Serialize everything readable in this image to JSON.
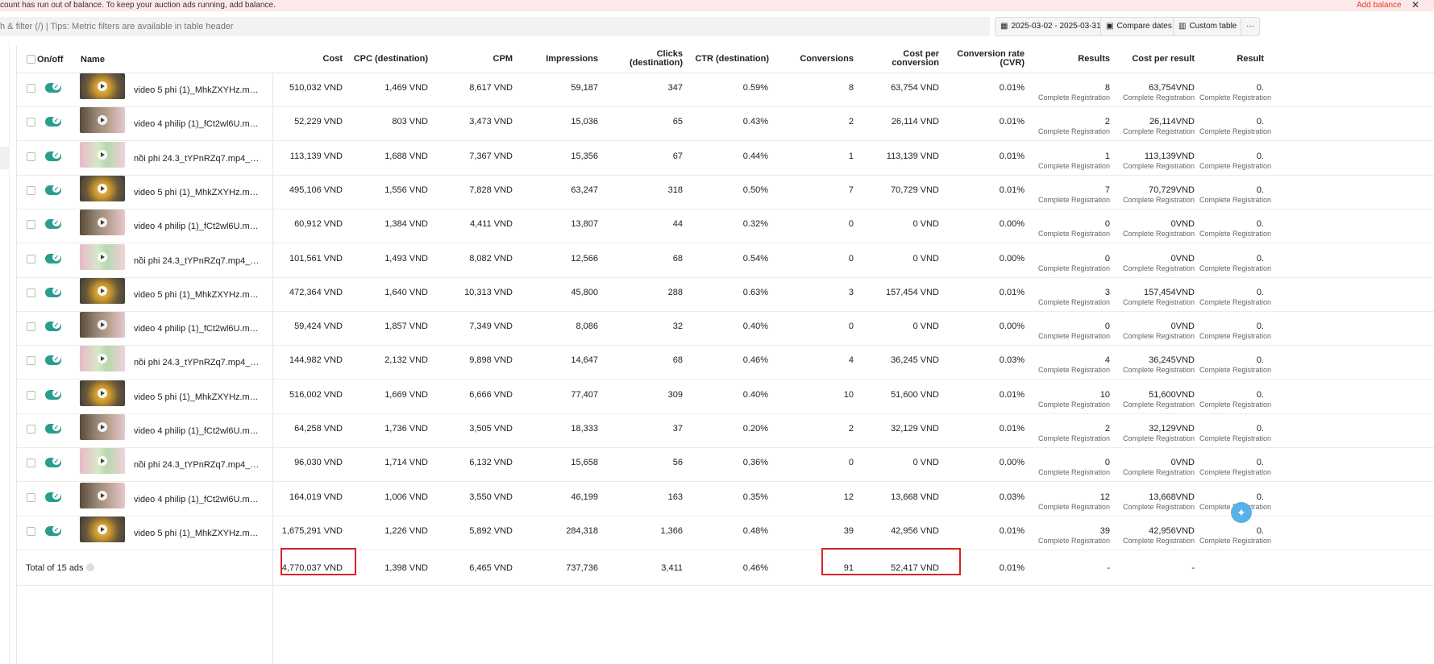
{
  "banner": {
    "message": "count has run out of balance. To keep your auction ads running, add balance.",
    "add_balance": "Add balance",
    "close": "✕"
  },
  "toolbar": {
    "search_placeholder": "h & filter (/) | Tips: Metric filters are available in table header",
    "date_range": "2025-03-02 - 2025-03-31",
    "compare_dates": "Compare dates",
    "custom_table": "Custom table",
    "more": "···"
  },
  "headers": {
    "onoff": "On/off",
    "name": "Name",
    "cost": "Cost",
    "cpc": "CPC (destination)",
    "cpm": "CPM",
    "impressions": "Impressions",
    "clicks_1": "Clicks",
    "clicks_2": "(destination)",
    "ctr": "CTR (destination)",
    "conversions": "Conversions",
    "cpconv_1": "Cost per",
    "cpconv_2": "conversion",
    "cvr_1": "Conversion rate",
    "cvr_2": "(CVR)",
    "results": "Results",
    "cpr": "Cost per result",
    "result_rate": "Result"
  },
  "sub_label": "Complete Registration",
  "rows": [
    {
      "thumb": "a",
      "name": "video 5 phi (1)_MhkZXYHz.mp4_Bả...",
      "cost": "510,032 VND",
      "cpc": "1,469 VND",
      "cpm": "8,617 VND",
      "impr": "59,187",
      "clicks": "347",
      "ctr": "0.59%",
      "conv": "8",
      "cpconv": "63,754 VND",
      "cvr": "0.01%",
      "results": "8",
      "cpr": "63,754VND",
      "rr": "0."
    },
    {
      "thumb": "b",
      "name": "video 4 philip (1)_fCt2wl6U.mp4_Bả...",
      "cost": "52,229 VND",
      "cpc": "803 VND",
      "cpm": "3,473 VND",
      "impr": "15,036",
      "clicks": "65",
      "ctr": "0.43%",
      "conv": "2",
      "cpconv": "26,114 VND",
      "cvr": "0.01%",
      "results": "2",
      "cpr": "26,114VND",
      "rr": "0."
    },
    {
      "thumb": "c",
      "name": "nồi phi 24.3_tYPnRZq7.mp4_2025-0...",
      "cost": "113,139 VND",
      "cpc": "1,688 VND",
      "cpm": "7,367 VND",
      "impr": "15,356",
      "clicks": "67",
      "ctr": "0.44%",
      "conv": "1",
      "cpconv": "113,139 VND",
      "cvr": "0.01%",
      "results": "1",
      "cpr": "113,139VND",
      "rr": "0."
    },
    {
      "thumb": "a",
      "name": "video 5 phi (1)_MhkZXYHz.mp4_Bả...",
      "cost": "495,106 VND",
      "cpc": "1,556 VND",
      "cpm": "7,828 VND",
      "impr": "63,247",
      "clicks": "318",
      "ctr": "0.50%",
      "conv": "7",
      "cpconv": "70,729 VND",
      "cvr": "0.01%",
      "results": "7",
      "cpr": "70,729VND",
      "rr": "0."
    },
    {
      "thumb": "b",
      "name": "video 4 philip (1)_fCt2wl6U.mp4_Bả...",
      "cost": "60,912 VND",
      "cpc": "1,384 VND",
      "cpm": "4,411 VND",
      "impr": "13,807",
      "clicks": "44",
      "ctr": "0.32%",
      "conv": "0",
      "cpconv": "0 VND",
      "cvr": "0.00%",
      "results": "0",
      "cpr": "0VND",
      "rr": "0."
    },
    {
      "thumb": "c",
      "name": "nồi phi 24.3_tYPnRZq7.mp4_2025-0...",
      "cost": "101,561 VND",
      "cpc": "1,493 VND",
      "cpm": "8,082 VND",
      "impr": "12,566",
      "clicks": "68",
      "ctr": "0.54%",
      "conv": "0",
      "cpconv": "0 VND",
      "cvr": "0.00%",
      "results": "0",
      "cpr": "0VND",
      "rr": "0."
    },
    {
      "thumb": "a",
      "name": "video 5 phi (1)_MhkZXYHz.mp4_Bả...",
      "cost": "472,364 VND",
      "cpc": "1,640 VND",
      "cpm": "10,313 VND",
      "impr": "45,800",
      "clicks": "288",
      "ctr": "0.63%",
      "conv": "3",
      "cpconv": "157,454 VND",
      "cvr": "0.01%",
      "results": "3",
      "cpr": "157,454VND",
      "rr": "0."
    },
    {
      "thumb": "b",
      "name": "video 4 philip (1)_fCt2wl6U.mp4_Bả...",
      "cost": "59,424 VND",
      "cpc": "1,857 VND",
      "cpm": "7,349 VND",
      "impr": "8,086",
      "clicks": "32",
      "ctr": "0.40%",
      "conv": "0",
      "cpconv": "0 VND",
      "cvr": "0.00%",
      "results": "0",
      "cpr": "0VND",
      "rr": "0."
    },
    {
      "thumb": "c",
      "name": "nồi phi 24.3_tYPnRZq7.mp4_2025-0...",
      "cost": "144,982 VND",
      "cpc": "2,132 VND",
      "cpm": "9,898 VND",
      "impr": "14,647",
      "clicks": "68",
      "ctr": "0.46%",
      "conv": "4",
      "cpconv": "36,245 VND",
      "cvr": "0.03%",
      "results": "4",
      "cpr": "36,245VND",
      "rr": "0."
    },
    {
      "thumb": "a",
      "name": "video 5 phi (1)_MhkZXYHz.mp4_Bả...",
      "cost": "516,002 VND",
      "cpc": "1,669 VND",
      "cpm": "6,666 VND",
      "impr": "77,407",
      "clicks": "309",
      "ctr": "0.40%",
      "conv": "10",
      "cpconv": "51,600 VND",
      "cvr": "0.01%",
      "results": "10",
      "cpr": "51,600VND",
      "rr": "0."
    },
    {
      "thumb": "b",
      "name": "video 4 philip (1)_fCt2wl6U.mp4_Bả...",
      "cost": "64,258 VND",
      "cpc": "1,736 VND",
      "cpm": "3,505 VND",
      "impr": "18,333",
      "clicks": "37",
      "ctr": "0.20%",
      "conv": "2",
      "cpconv": "32,129 VND",
      "cvr": "0.01%",
      "results": "2",
      "cpr": "32,129VND",
      "rr": "0."
    },
    {
      "thumb": "c",
      "name": "nồi phi 24.3_tYPnRZq7.mp4_2025-0...",
      "cost": "96,030 VND",
      "cpc": "1,714 VND",
      "cpm": "6,132 VND",
      "impr": "15,658",
      "clicks": "56",
      "ctr": "0.36%",
      "conv": "0",
      "cpconv": "0 VND",
      "cvr": "0.00%",
      "results": "0",
      "cpr": "0VND",
      "rr": "0."
    },
    {
      "thumb": "b",
      "name": "video 4 philip (1)_fCt2wl6U.mp4_Bả...",
      "cost": "164,019 VND",
      "cpc": "1,006 VND",
      "cpm": "3,550 VND",
      "impr": "46,199",
      "clicks": "163",
      "ctr": "0.35%",
      "conv": "12",
      "cpconv": "13,668 VND",
      "cvr": "0.03%",
      "results": "12",
      "cpr": "13,668VND",
      "rr": "0."
    },
    {
      "thumb": "a",
      "name": "video 5 phi (1)_MhkZXYHz.mp4_Bả...",
      "cost": "1,675,291 VND",
      "cpc": "1,226 VND",
      "cpm": "5,892 VND",
      "impr": "284,318",
      "clicks": "1,366",
      "ctr": "0.48%",
      "conv": "39",
      "cpconv": "42,956 VND",
      "cvr": "0.01%",
      "results": "39",
      "cpr": "42,956VND",
      "rr": "0."
    }
  ],
  "total": {
    "label": "Total of 15 ads",
    "cost": "4,770,037 VND",
    "cpc": "1,398 VND",
    "cpm": "6,465 VND",
    "impr": "737,736",
    "clicks": "3,411",
    "ctr": "0.46%",
    "conv": "91",
    "cpconv": "52,417 VND",
    "cvr": "0.01%",
    "results": "-",
    "cpr": "-"
  },
  "colors": {
    "accent": "#2a9d8f",
    "alert": "#d8232a",
    "banner_bg": "#fde9e9"
  }
}
